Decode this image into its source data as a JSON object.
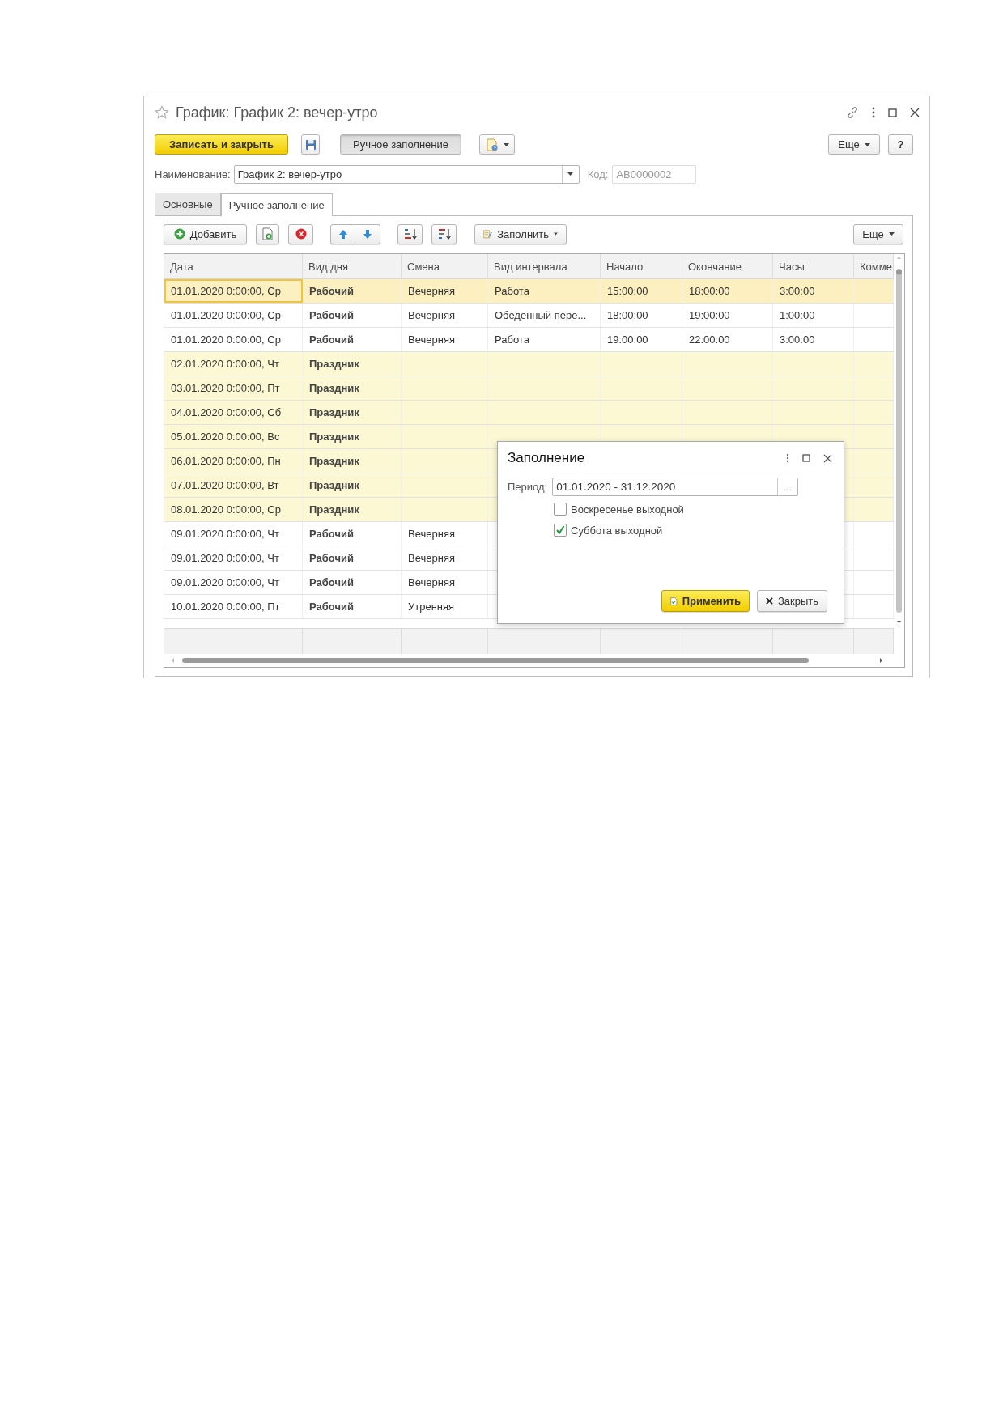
{
  "window": {
    "title": "График: График 2: вечер-утро"
  },
  "toolbar": {
    "save_close": "Записать и закрыть",
    "manual_fill": {
      "label": "Ручное заполнение",
      "pressed": true
    },
    "more": "Еще",
    "help": "?"
  },
  "name_field": {
    "label": "Наименование:",
    "value": "График 2: вечер-утро"
  },
  "code_field": {
    "label": "Код:",
    "value": "AB0000002",
    "disabled": true
  },
  "tabs": [
    {
      "label": "Основные",
      "selected": false
    },
    {
      "label": "Ручное заполнение",
      "selected": true
    }
  ],
  "table_toolbar": {
    "add": "Добавить",
    "fill": "Заполнить",
    "more": "Еще"
  },
  "table": {
    "columns": [
      "Дата",
      "Вид дня",
      "Смена",
      "Вид интервала",
      "Начало",
      "Окончание",
      "Часы",
      "Комме"
    ],
    "rows": [
      {
        "kind": "work",
        "selected": true,
        "cells": [
          "01.01.2020 0:00:00, Ср",
          "Рабочий",
          "Вечерняя",
          "Работа",
          "15:00:00",
          "18:00:00",
          "3:00:00"
        ]
      },
      {
        "kind": "work",
        "selected": false,
        "cells": [
          "01.01.2020 0:00:00, Ср",
          "Рабочий",
          "Вечерняя",
          "Обеденный пере...",
          "18:00:00",
          "19:00:00",
          "1:00:00"
        ]
      },
      {
        "kind": "work",
        "selected": false,
        "cells": [
          "01.01.2020 0:00:00, Ср",
          "Рабочий",
          "Вечерняя",
          "Работа",
          "19:00:00",
          "22:00:00",
          "3:00:00"
        ]
      },
      {
        "kind": "holiday",
        "selected": false,
        "cells": [
          "02.01.2020 0:00:00, Чт",
          "Праздник"
        ]
      },
      {
        "kind": "holiday",
        "selected": false,
        "cells": [
          "03.01.2020 0:00:00, Пт",
          "Праздник"
        ]
      },
      {
        "kind": "holiday",
        "selected": false,
        "cells": [
          "04.01.2020 0:00:00, Сб",
          "Праздник"
        ]
      },
      {
        "kind": "holiday",
        "selected": false,
        "cells": [
          "05.01.2020 0:00:00, Вс",
          "Праздник"
        ]
      },
      {
        "kind": "holiday",
        "selected": false,
        "cells": [
          "06.01.2020 0:00:00, Пн",
          "Праздник"
        ]
      },
      {
        "kind": "holiday",
        "selected": false,
        "cells": [
          "07.01.2020 0:00:00, Вт",
          "Праздник"
        ]
      },
      {
        "kind": "holiday",
        "selected": false,
        "cells": [
          "08.01.2020 0:00:00, Ср",
          "Праздник"
        ]
      },
      {
        "kind": "work",
        "selected": false,
        "cells": [
          "09.01.2020 0:00:00, Чт",
          "Рабочий",
          "Вечерняя"
        ]
      },
      {
        "kind": "work",
        "selected": false,
        "cells": [
          "09.01.2020 0:00:00, Чт",
          "Рабочий",
          "Вечерняя"
        ]
      },
      {
        "kind": "work",
        "selected": false,
        "cells": [
          "09.01.2020 0:00:00, Чт",
          "Рабочий",
          "Вечерняя"
        ]
      },
      {
        "kind": "work",
        "selected": false,
        "cells": [
          "10.01.2020 0:00:00, Пт",
          "Рабочий",
          "Утренняя"
        ]
      }
    ]
  },
  "dialog": {
    "title": "Заполнение",
    "period_label": "Период:",
    "period_value": "01.01.2020 - 31.12.2020",
    "choose_button": "...",
    "checkboxes": [
      {
        "label": "Воскресенье выходной",
        "checked": false
      },
      {
        "label": "Суббота выходной",
        "checked": true
      }
    ],
    "apply": "Применить",
    "close": "Закрыть"
  }
}
